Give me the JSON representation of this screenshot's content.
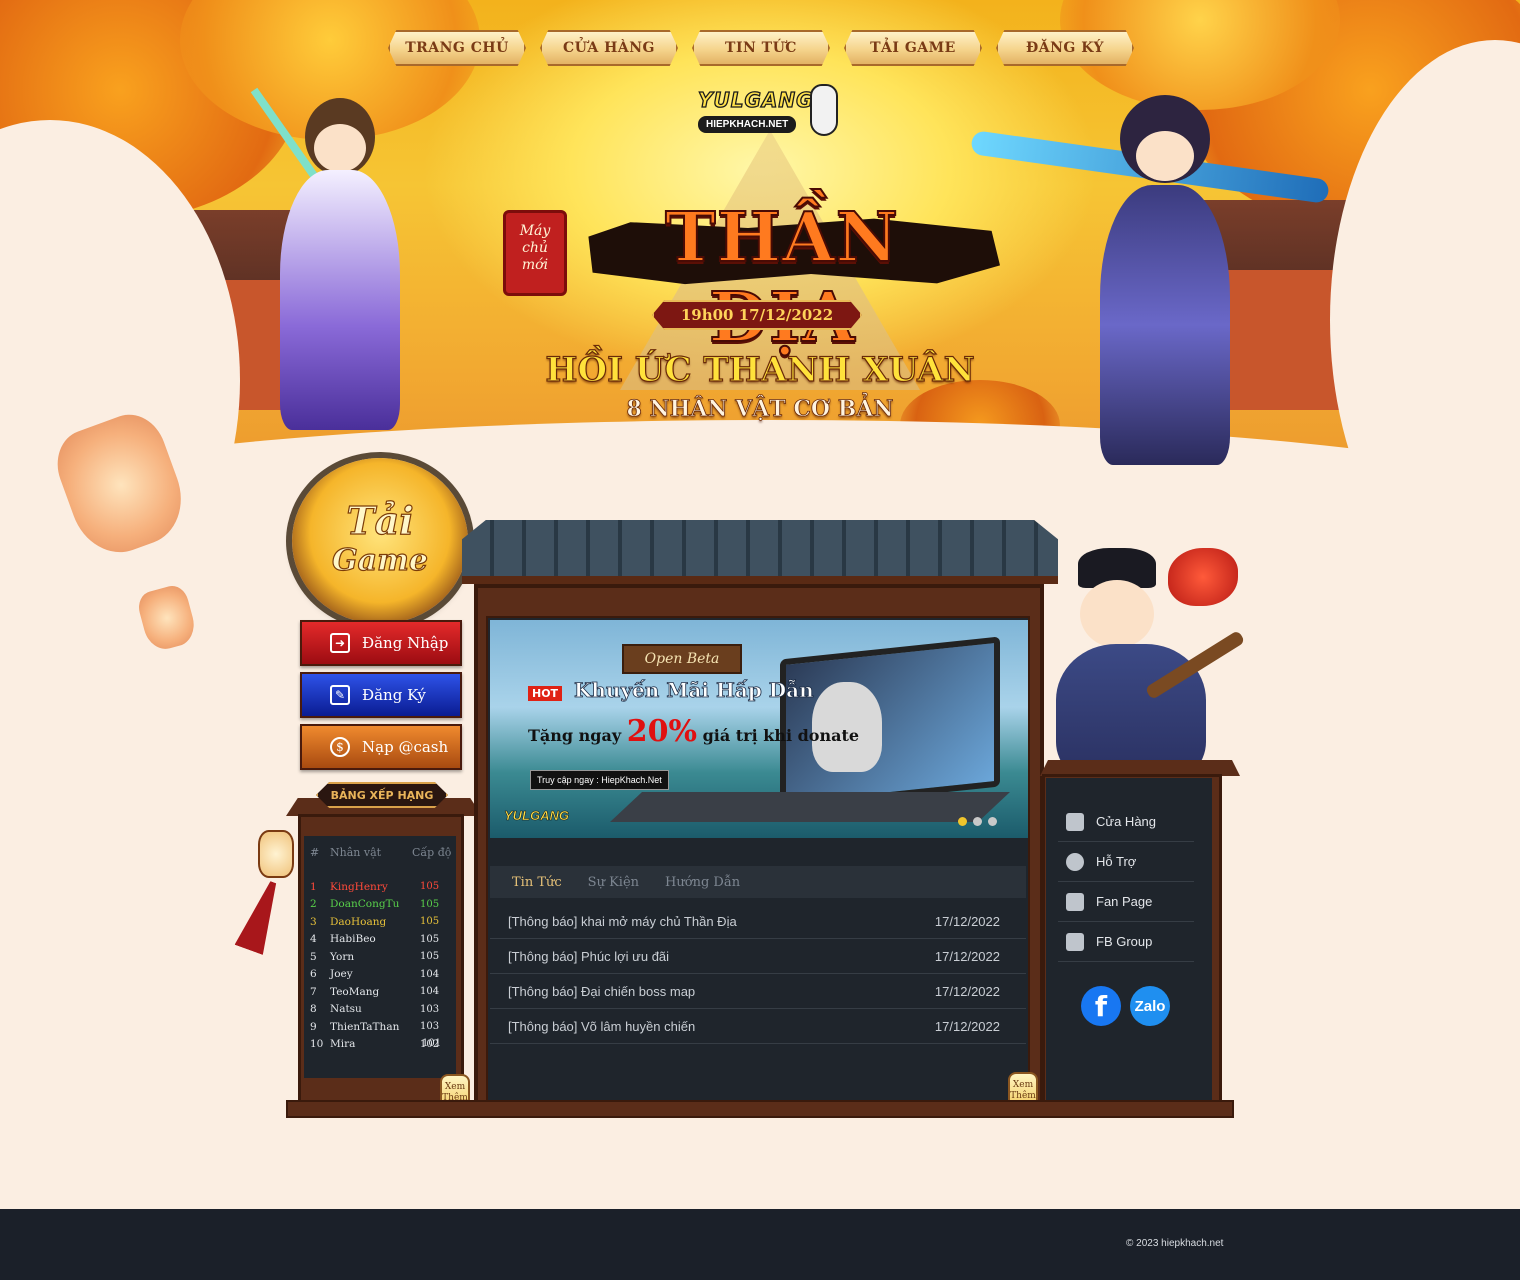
{
  "nav": {
    "items": [
      "TRANG CHỦ",
      "CỬA HÀNG",
      "TIN TỨC",
      "TẢI GAME",
      "ĐĂNG KÝ"
    ]
  },
  "logo": {
    "top": "YULGANG",
    "bottom": "HIEPKHACH.NET"
  },
  "event": {
    "stamp": [
      "Máy",
      "chủ",
      "mới"
    ],
    "title": "THẦN ĐỊA",
    "date": "19h00 17/12/2022",
    "subtitle": "HỒI ỨC THANH XUÂN",
    "subtitle2": "8 NHÂN VẬT CƠ BẢN"
  },
  "download": {
    "line1": "Tải",
    "line2": "Game"
  },
  "actions": {
    "login": "Đăng Nhập",
    "register": "Đăng Ký",
    "topup": "Nạp @cash"
  },
  "banner": {
    "badge": "Open Beta",
    "hot": "HOT",
    "title": "Khuyến Mãi Hấp Dẫn",
    "sub_pre": "Tặng ngay",
    "sub_pct": "20%",
    "sub_post": "giá trị khi donate",
    "url": "Truy cập ngay : HiepKhach.Net",
    "logo": "YULGANG",
    "slides": 3,
    "active_slide": 1
  },
  "ranking": {
    "title": "BẢNG XẾP HẠNG",
    "headers": [
      "#",
      "Nhân vật",
      "Cấp độ"
    ],
    "rows": [
      {
        "rank": "1",
        "name": "KingHenry",
        "level": "105"
      },
      {
        "rank": "2",
        "name": "DoanCongTu",
        "level": "105"
      },
      {
        "rank": "3",
        "name": "DaoHoang",
        "level": "105"
      },
      {
        "rank": "4",
        "name": "HabiBeo",
        "level": "105"
      },
      {
        "rank": "5",
        "name": "Yorn",
        "level": "105"
      },
      {
        "rank": "6",
        "name": "Joey",
        "level": "104"
      },
      {
        "rank": "7",
        "name": "TeoMang",
        "level": "104"
      },
      {
        "rank": "8",
        "name": "Natsu",
        "level": "103"
      },
      {
        "rank": "9",
        "name": "ThienTaThan",
        "level": "103"
      },
      {
        "rank": "10",
        "name": "Mira",
        "level": "102"
      }
    ],
    "extra_levels": [
      "101"
    ],
    "colors": {
      "first": "#ff4a3a",
      "second": "#58d04a",
      "third": "#e6c13a",
      "rest": "#e3e6ea"
    },
    "more": "Xem Thêm"
  },
  "news": {
    "tabs": [
      "Tin Tức",
      "Sự Kiện",
      "Hướng Dẫn"
    ],
    "items": [
      {
        "title": "[Thông báo] khai mở máy chủ Thần Địa",
        "date": "17/12/2022"
      },
      {
        "title": "[Thông báo] Phúc lợi ưu đãi",
        "date": "17/12/2022"
      },
      {
        "title": "[Thông báo] Đại chiến boss map",
        "date": "17/12/2022"
      },
      {
        "title": "[Thông báo] Võ lâm huyền chiến",
        "date": "17/12/2022"
      }
    ],
    "more": "Xem Thêm"
  },
  "links": [
    {
      "label": "Cửa Hàng",
      "icon": "store-icon"
    },
    {
      "label": "Hỗ Trợ",
      "icon": "support-icon"
    },
    {
      "label": "Fan Page",
      "icon": "facebook-square-icon"
    },
    {
      "label": "FB Group",
      "icon": "group-icon"
    }
  ],
  "social": {
    "facebook": "f",
    "zalo": "Zalo"
  },
  "footer": {
    "copyright": "© 2023 hiepkhach.net"
  }
}
